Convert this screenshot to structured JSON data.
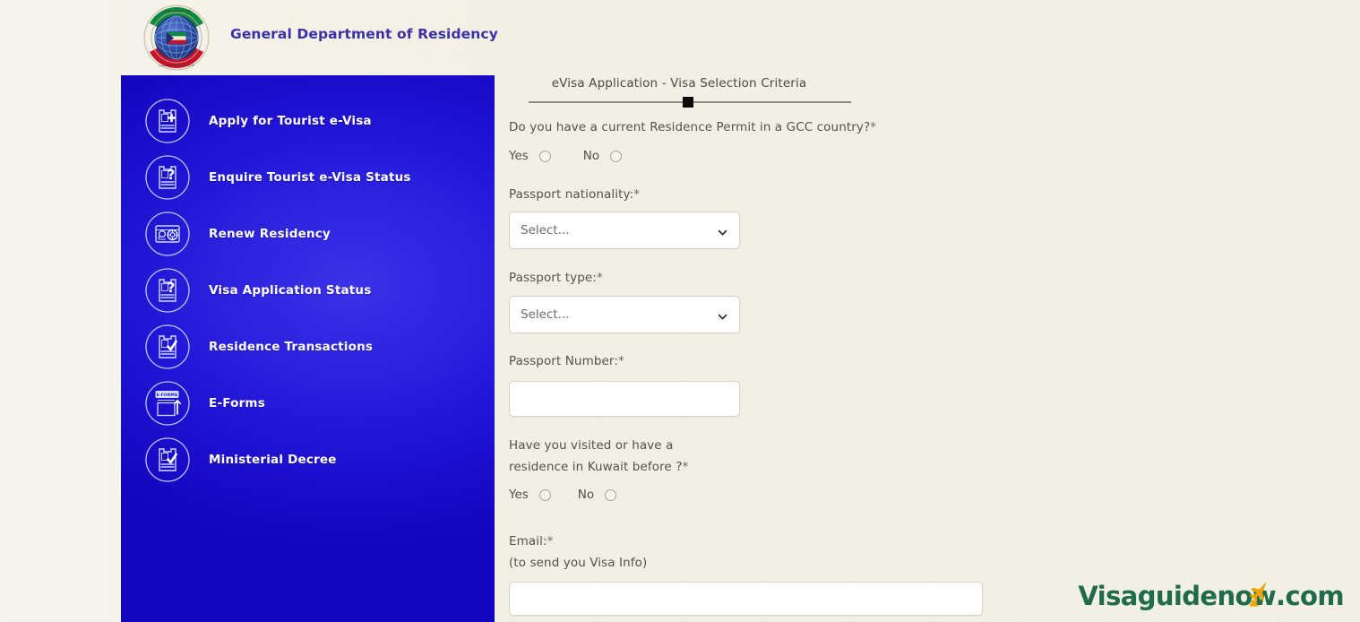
{
  "header": {
    "title": "General Department of Residency",
    "logo_icon": "kuwait-residency-emblem",
    "title_color": "#3b31a5"
  },
  "sidebar": {
    "background_color": "#1d10cf",
    "items": [
      {
        "label": "Apply for Tourist e-Visa",
        "icon": "document-plus-icon"
      },
      {
        "label": "Enquire Tourist e-Visa Status",
        "icon": "document-question-icon"
      },
      {
        "label": "Renew Residency",
        "icon": "id-card-renew-icon"
      },
      {
        "label": "Visa Application Status",
        "icon": "document-question-icon"
      },
      {
        "label": "Residence Transactions",
        "icon": "document-check-icon"
      },
      {
        "label": "E-Forms",
        "icon": "e-form-upload-icon"
      },
      {
        "label": "Ministerial Decree",
        "icon": "document-check-icon"
      }
    ]
  },
  "form": {
    "heading": "eVisa Application - Visa Selection Criteria",
    "progress": {
      "marker_position_percent": 48
    },
    "gcc_question": {
      "label": "Do you have a current Residence Permit in a GCC country?",
      "required_mark": "*",
      "options": [
        {
          "label": "Yes",
          "selected": false
        },
        {
          "label": "No",
          "selected": false
        }
      ]
    },
    "passport_nationality": {
      "label": "Passport nationality:",
      "required_mark": "*",
      "value": "Select...",
      "chevron_icon": "chevron-down-icon"
    },
    "passport_type": {
      "label": "Passport type:",
      "required_mark": "*",
      "value": "Select...",
      "chevron_icon": "chevron-down-icon"
    },
    "passport_number": {
      "label": "Passport Number:",
      "required_mark": "*",
      "value": "",
      "placeholder": ""
    },
    "kuwait_question": {
      "label_line1": "Have you visited or have a",
      "label_line2": "residence in Kuwait before ?",
      "required_mark": "*",
      "options": [
        {
          "label": "Yes",
          "selected": false
        },
        {
          "label": "No",
          "selected": false
        }
      ]
    },
    "email": {
      "label": "Email:",
      "required_mark": "*",
      "hint": "(to send you Visa Info)",
      "value": "",
      "placeholder": ""
    }
  },
  "watermark": {
    "text_part1": "Visaguidenow",
    "text_part2": ".com",
    "icon": "airplane-takeoff-icon",
    "text_color": "#1f6b4a",
    "accent_color": "#f0a400"
  }
}
